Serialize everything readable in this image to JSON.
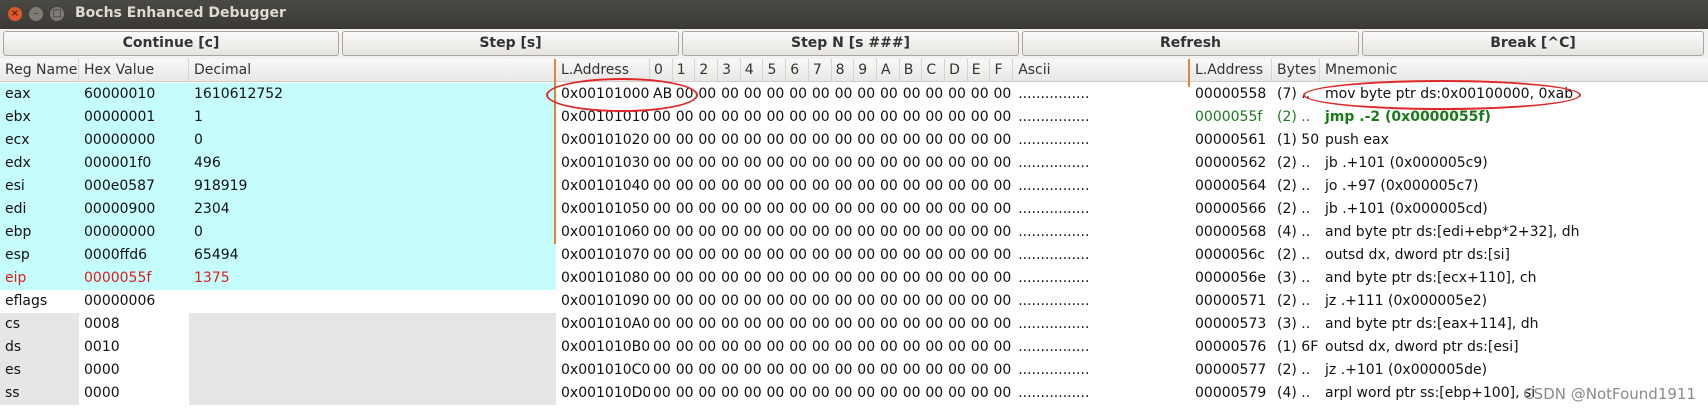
{
  "window": {
    "title": "Bochs Enhanced Debugger",
    "close": "×",
    "minimize": "–",
    "maximize": "□"
  },
  "toolbar": [
    "Continue [c]",
    "Step [s]",
    "Step N [s ###]",
    "Refresh",
    "Break [^C]"
  ],
  "registers": {
    "headers": [
      "Reg Name",
      "Hex Value",
      "Decimal"
    ],
    "rows": [
      {
        "name": "eax",
        "hex": "60000010",
        "dec": "1610612752",
        "style": "gp"
      },
      {
        "name": "ebx",
        "hex": "00000001",
        "dec": "1",
        "style": "gp"
      },
      {
        "name": "ecx",
        "hex": "00000000",
        "dec": "0",
        "style": "gp"
      },
      {
        "name": "edx",
        "hex": "000001f0",
        "dec": "496",
        "style": "gp"
      },
      {
        "name": "esi",
        "hex": "000e0587",
        "dec": "918919",
        "style": "gp"
      },
      {
        "name": "edi",
        "hex": "00000900",
        "dec": "2304",
        "style": "gp"
      },
      {
        "name": "ebp",
        "hex": "00000000",
        "dec": "0",
        "style": "gp"
      },
      {
        "name": "esp",
        "hex": "0000ffd6",
        "dec": "65494",
        "style": "gp"
      },
      {
        "name": "eip",
        "hex": "0000055f",
        "dec": "1375",
        "style": "eip"
      },
      {
        "name": "eflags",
        "hex": "00000006",
        "dec": "",
        "style": "flags"
      },
      {
        "name": "cs",
        "hex": "0008",
        "dec": "",
        "style": "seg"
      },
      {
        "name": "ds",
        "hex": "0010",
        "dec": "",
        "style": "seg"
      },
      {
        "name": "es",
        "hex": "0000",
        "dec": "",
        "style": "seg"
      },
      {
        "name": "ss",
        "hex": "0000",
        "dec": "",
        "style": "seg"
      }
    ]
  },
  "memory": {
    "headers": [
      "L.Address",
      "0",
      "1",
      "2",
      "3",
      "4",
      "5",
      "6",
      "7",
      "8",
      "9",
      "A",
      "B",
      "C",
      "D",
      "E",
      "F",
      "Ascii"
    ],
    "rows": [
      {
        "addr": "0x00101000",
        "bytes": [
          "AB",
          "00",
          "00",
          "00",
          "00",
          "00",
          "00",
          "00",
          "00",
          "00",
          "00",
          "00",
          "00",
          "00",
          "00",
          "00"
        ],
        "ascii": "................"
      },
      {
        "addr": "0x00101010",
        "bytes": [
          "00",
          "00",
          "00",
          "00",
          "00",
          "00",
          "00",
          "00",
          "00",
          "00",
          "00",
          "00",
          "00",
          "00",
          "00",
          "00"
        ],
        "ascii": "................"
      },
      {
        "addr": "0x00101020",
        "bytes": [
          "00",
          "00",
          "00",
          "00",
          "00",
          "00",
          "00",
          "00",
          "00",
          "00",
          "00",
          "00",
          "00",
          "00",
          "00",
          "00"
        ],
        "ascii": "................"
      },
      {
        "addr": "0x00101030",
        "bytes": [
          "00",
          "00",
          "00",
          "00",
          "00",
          "00",
          "00",
          "00",
          "00",
          "00",
          "00",
          "00",
          "00",
          "00",
          "00",
          "00"
        ],
        "ascii": "................"
      },
      {
        "addr": "0x00101040",
        "bytes": [
          "00",
          "00",
          "00",
          "00",
          "00",
          "00",
          "00",
          "00",
          "00",
          "00",
          "00",
          "00",
          "00",
          "00",
          "00",
          "00"
        ],
        "ascii": "................"
      },
      {
        "addr": "0x00101050",
        "bytes": [
          "00",
          "00",
          "00",
          "00",
          "00",
          "00",
          "00",
          "00",
          "00",
          "00",
          "00",
          "00",
          "00",
          "00",
          "00",
          "00"
        ],
        "ascii": "................"
      },
      {
        "addr": "0x00101060",
        "bytes": [
          "00",
          "00",
          "00",
          "00",
          "00",
          "00",
          "00",
          "00",
          "00",
          "00",
          "00",
          "00",
          "00",
          "00",
          "00",
          "00"
        ],
        "ascii": "................"
      },
      {
        "addr": "0x00101070",
        "bytes": [
          "00",
          "00",
          "00",
          "00",
          "00",
          "00",
          "00",
          "00",
          "00",
          "00",
          "00",
          "00",
          "00",
          "00",
          "00",
          "00"
        ],
        "ascii": "................"
      },
      {
        "addr": "0x00101080",
        "bytes": [
          "00",
          "00",
          "00",
          "00",
          "00",
          "00",
          "00",
          "00",
          "00",
          "00",
          "00",
          "00",
          "00",
          "00",
          "00",
          "00"
        ],
        "ascii": "................"
      },
      {
        "addr": "0x00101090",
        "bytes": [
          "00",
          "00",
          "00",
          "00",
          "00",
          "00",
          "00",
          "00",
          "00",
          "00",
          "00",
          "00",
          "00",
          "00",
          "00",
          "00"
        ],
        "ascii": "................"
      },
      {
        "addr": "0x001010A0",
        "bytes": [
          "00",
          "00",
          "00",
          "00",
          "00",
          "00",
          "00",
          "00",
          "00",
          "00",
          "00",
          "00",
          "00",
          "00",
          "00",
          "00"
        ],
        "ascii": "................"
      },
      {
        "addr": "0x001010B0",
        "bytes": [
          "00",
          "00",
          "00",
          "00",
          "00",
          "00",
          "00",
          "00",
          "00",
          "00",
          "00",
          "00",
          "00",
          "00",
          "00",
          "00"
        ],
        "ascii": "................"
      },
      {
        "addr": "0x001010C0",
        "bytes": [
          "00",
          "00",
          "00",
          "00",
          "00",
          "00",
          "00",
          "00",
          "00",
          "00",
          "00",
          "00",
          "00",
          "00",
          "00",
          "00"
        ],
        "ascii": "................"
      },
      {
        "addr": "0x001010D0",
        "bytes": [
          "00",
          "00",
          "00",
          "00",
          "00",
          "00",
          "00",
          "00",
          "00",
          "00",
          "00",
          "00",
          "00",
          "00",
          "00",
          "00"
        ],
        "ascii": "................"
      }
    ]
  },
  "disasm": {
    "headers": [
      "L.Address",
      "Bytes",
      "Mnemonic"
    ],
    "rows": [
      {
        "addr": "00000558",
        "bytes": "(7) ..",
        "mnem": "mov byte ptr ds:0x00100000, 0xab",
        "style": "normal"
      },
      {
        "addr": "0000055f",
        "bytes": "(2) ..",
        "mnem": "jmp .-2  (0x0000055f)",
        "style": "current"
      },
      {
        "addr": "00000561",
        "bytes": "(1) 50",
        "mnem": "push eax",
        "style": "normal"
      },
      {
        "addr": "00000562",
        "bytes": "(2) ..",
        "mnem": "jb .+101  (0x000005c9)",
        "style": "normal"
      },
      {
        "addr": "00000564",
        "bytes": "(2) ..",
        "mnem": "jo .+97  (0x000005c7)",
        "style": "normal"
      },
      {
        "addr": "00000566",
        "bytes": "(2) ..",
        "mnem": "jb .+101  (0x000005cd)",
        "style": "normal"
      },
      {
        "addr": "00000568",
        "bytes": "(4) ..",
        "mnem": "and byte ptr ds:[edi+ebp*2+32], dh",
        "style": "normal"
      },
      {
        "addr": "0000056c",
        "bytes": "(2) ..",
        "mnem": "outsd dx, dword ptr ds:[si]",
        "style": "normal"
      },
      {
        "addr": "0000056e",
        "bytes": "(3) ..",
        "mnem": "and byte ptr ds:[ecx+110], ch",
        "style": "normal"
      },
      {
        "addr": "00000571",
        "bytes": "(2) ..",
        "mnem": "jz .+111  (0x000005e2)",
        "style": "normal"
      },
      {
        "addr": "00000573",
        "bytes": "(3) ..",
        "mnem": "and byte ptr ds:[eax+114], dh",
        "style": "normal"
      },
      {
        "addr": "00000576",
        "bytes": "(1) 6F",
        "mnem": "outsd dx, dword ptr ds:[esi]",
        "style": "normal"
      },
      {
        "addr": "00000577",
        "bytes": "(2) ..",
        "mnem": "jz .+101  (0x000005de)",
        "style": "normal"
      },
      {
        "addr": "00000579",
        "bytes": "(4) ..",
        "mnem": "arpl word ptr ss:[ebp+100], si",
        "style": "normal"
      }
    ]
  },
  "watermark": "CSDN @NotFound1911",
  "colors": {
    "gp_bg": "#c5fdfd",
    "seg_bg": "#e6e6e6",
    "eip_text": "#e01b1b",
    "current_text": "#1a7a1a",
    "annotation": "#e02828",
    "divider": "#e8823a"
  }
}
